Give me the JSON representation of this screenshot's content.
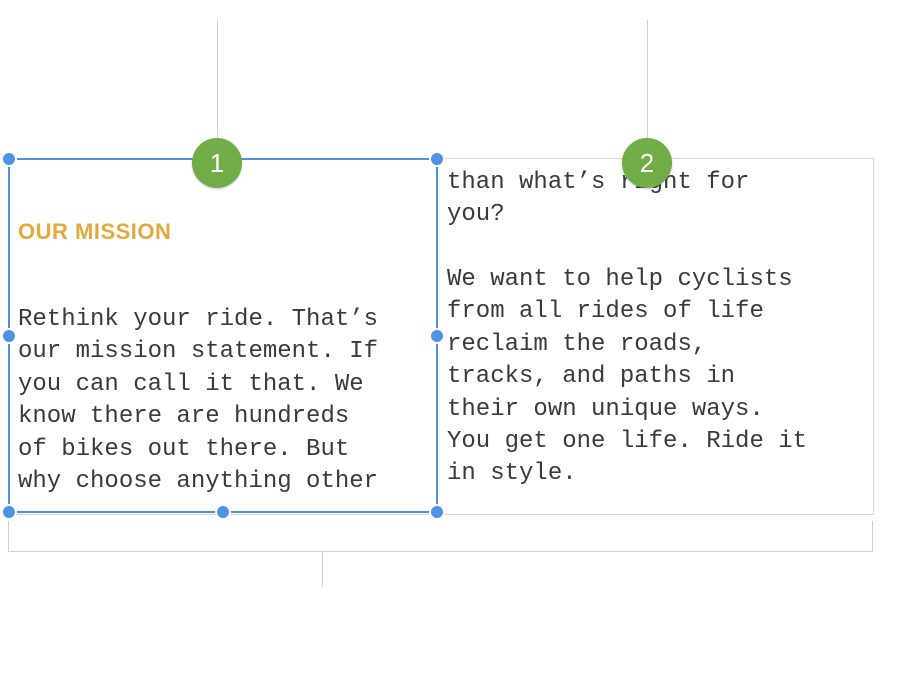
{
  "callouts": {
    "badge1": "1",
    "badge2": "2"
  },
  "textbox": {
    "heading": "OUR MISSION",
    "column1": "Rethink your ride. That’s\nour mission statement. If\nyou can call it that. We\nknow there are hundreds\nof bikes out there. But\nwhy choose anything other",
    "column2_part1": "than what’s right for\nyou?",
    "column2_part2": "We want to help cyclists\nfrom all rides of life\nreclaim the roads,\ntracks, and paths in\ntheir own unique ways.\nYou get one life. Ride it\nin style."
  }
}
